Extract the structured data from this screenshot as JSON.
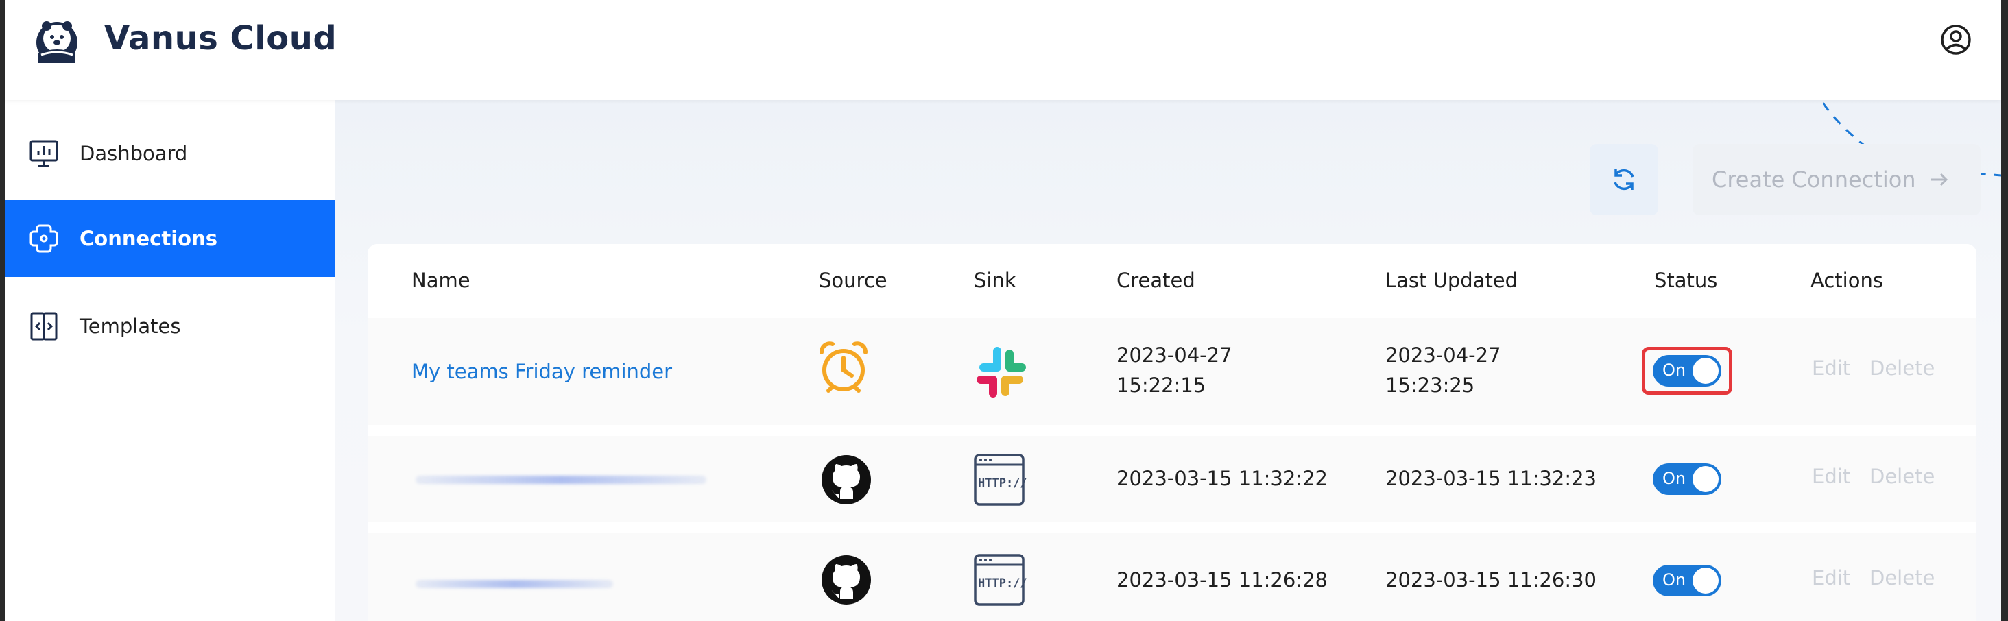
{
  "app": {
    "title": "Vanus Cloud",
    "logo_icon": "otter-logo-icon",
    "account_icon": "user-circle-icon"
  },
  "sidebar": {
    "items": [
      {
        "label": "Dashboard",
        "icon": "monitor-chart-icon",
        "active": false
      },
      {
        "label": "Connections",
        "icon": "connection-plug-icon",
        "active": true
      },
      {
        "label": "Templates",
        "icon": "template-code-icon",
        "active": false
      }
    ]
  },
  "toolbar": {
    "refresh_icon": "refresh-icon",
    "create_label": "Create Connection",
    "create_icon": "arrow-right-icon"
  },
  "table": {
    "columns": [
      "Name",
      "Source",
      "Sink",
      "Created",
      "Last Updated",
      "Status",
      "Actions"
    ],
    "rows": [
      {
        "name": "My teams Friday reminder",
        "source_icon": "alarm-clock-icon",
        "sink_icon": "slack-icon",
        "created_date": "2023-04-27",
        "created_time": "15:22:15",
        "updated_date": "2023-04-27",
        "updated_time": "15:23:25",
        "status": "On",
        "edit": "Edit",
        "delete": "Delete"
      },
      {
        "name": "",
        "source_icon": "github-icon",
        "sink_icon": "http-icon",
        "created": "2023-03-15 11:32:22",
        "updated": "2023-03-15 11:32:23",
        "status": "On",
        "edit": "Edit",
        "delete": "Delete"
      },
      {
        "name": "",
        "source_icon": "github-icon",
        "sink_icon": "http-icon",
        "created": "2023-03-15 11:26:28",
        "updated": "2023-03-15 11:26:30",
        "status": "On",
        "edit": "Edit",
        "delete": "Delete"
      }
    ]
  },
  "colors": {
    "accent": "#0d6efd",
    "link": "#1a78d6",
    "toggle_on": "#1a78d6",
    "highlight": "#e5383b",
    "clock": "#f5a623"
  }
}
